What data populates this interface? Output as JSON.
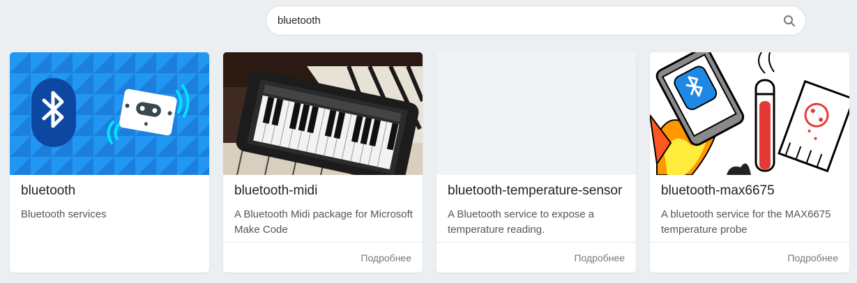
{
  "search": {
    "value": "bluetooth",
    "placeholder": ""
  },
  "cards": [
    {
      "title": "bluetooth",
      "description": "Bluetooth services",
      "more_label": ""
    },
    {
      "title": "bluetooth-midi",
      "description": "A Bluetooth Midi package for Microsoft Make Code",
      "more_label": "Подробнее"
    },
    {
      "title": "bluetooth-temperature-sensor",
      "description": "A Bluetooth service to expose a temperature reading.",
      "more_label": "Подробнее"
    },
    {
      "title": "bluetooth-max6675",
      "description": "A bluetooth service for the MAX6675 temperature probe",
      "more_label": "Подробнее"
    }
  ],
  "colors": {
    "page_bg": "#eceff1",
    "bluetooth_blue": "#1e88e5",
    "bluetooth_dark": "#0d47a1",
    "accent_cyan": "#00e5ff"
  },
  "icons": [
    "search-icon",
    "bluetooth-icon",
    "microbit-icon",
    "piano-keyboard-image",
    "phone-bluetooth-flame-sketch"
  ]
}
